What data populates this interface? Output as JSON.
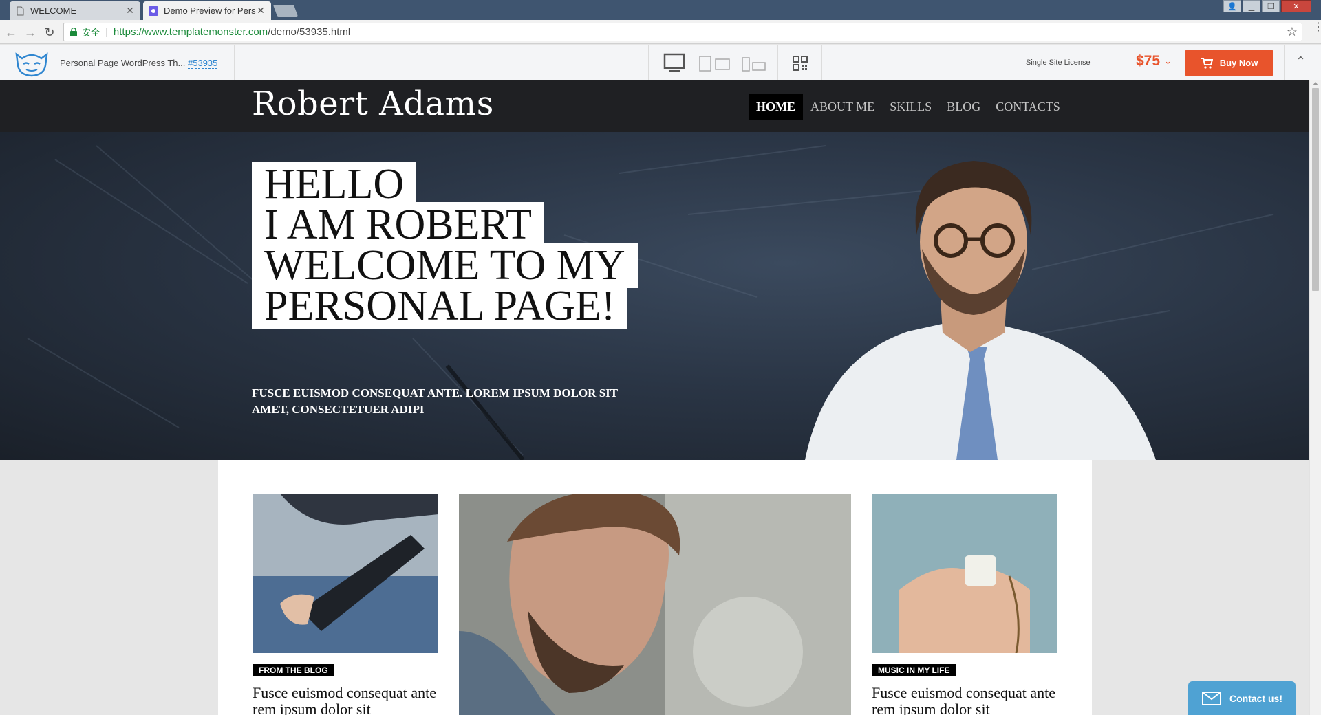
{
  "browser": {
    "tabs": [
      {
        "title": "WELCOME",
        "active": false
      },
      {
        "title": "Demo Preview for Perso",
        "active": true
      }
    ],
    "address": {
      "secure_label": "安全",
      "url_host": "https://www.templatemonster.com",
      "url_path": "/demo/53935.html"
    }
  },
  "tm_bar": {
    "product_name": "Personal Page WordPress Th...",
    "product_id": "#53935",
    "license": "Single Site License",
    "price": "$75",
    "buy_label": "Buy Now"
  },
  "site": {
    "brand": "Robert Adams",
    "nav": [
      {
        "label": "HOME",
        "active": true
      },
      {
        "label": "ABOUT ME",
        "active": false
      },
      {
        "label": "SKILLS",
        "active": false
      },
      {
        "label": "BLOG",
        "active": false
      },
      {
        "label": "CONTACTS",
        "active": false
      }
    ],
    "hero": {
      "lines": [
        "HELLO",
        "I AM ROBERT",
        "WELCOME TO MY",
        "PERSONAL PAGE!"
      ],
      "subtitle": "FUSCE EUISMOD CONSEQUAT ANTE. LOREM IPSUM DOLOR SIT AMET, CONSECTETUER ADIPI"
    },
    "cards": [
      {
        "tag": "FROM THE BLOG",
        "title": "Fusce euismod consequat ante rem ipsum dolor sit"
      },
      {
        "tag": "MUSIC IN MY LIFE",
        "title": "Fusce euismod consequat ante rem ipsum dolor sit"
      }
    ],
    "contact_label": "Contact us!"
  },
  "colors": {
    "accent_orange": "#e8542c",
    "tm_blue": "#2f86d0",
    "header_dark": "#1f2023",
    "contact_blue": "#4fa2d3"
  }
}
